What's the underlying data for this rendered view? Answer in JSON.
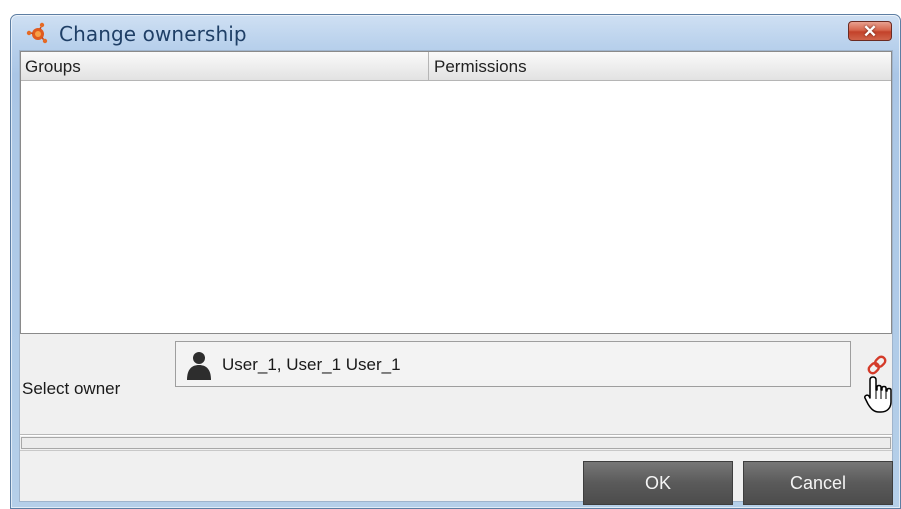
{
  "dialog": {
    "title": "Change ownership",
    "close_label": "✕"
  },
  "table": {
    "columns": [
      "Groups",
      "Permissions"
    ],
    "rows": []
  },
  "owner": {
    "label": "Select owner",
    "value": "User_1, User_1 User_1"
  },
  "buttons": {
    "ok": "OK",
    "cancel": "Cancel"
  },
  "icons": {
    "app": "molecule-app-icon",
    "user": "user-icon",
    "link": "link-icon",
    "cursor": "hand-cursor-icon"
  },
  "colors": {
    "link_icon": "#d43b2a",
    "button_bg": "#5a5a5a"
  }
}
